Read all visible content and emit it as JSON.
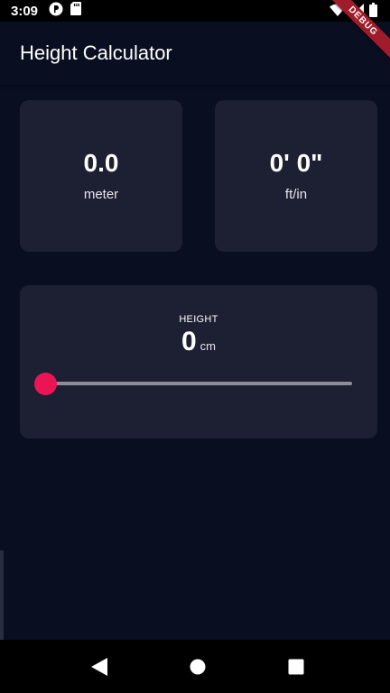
{
  "status_bar": {
    "time": "3:09",
    "icons_left": [
      "fuchsia-icon",
      "sd-card-icon"
    ],
    "icons_right": [
      "wifi-icon",
      "signal-icon",
      "battery-icon"
    ]
  },
  "debug_banner": "DEBUG",
  "app_bar": {
    "title": "Height Calculator"
  },
  "meter_card": {
    "value": "0.0",
    "unit": "meter"
  },
  "ftin_card": {
    "value": "0' 0\"",
    "unit": "ft/in"
  },
  "height_card": {
    "label": "HEIGHT",
    "value": "0",
    "unit": "cm",
    "slider_fraction": 0
  },
  "nav_bar": {
    "buttons": [
      "back-icon",
      "home-icon",
      "recents-icon"
    ]
  },
  "colors": {
    "background": "#0a0e21",
    "card": "#1d1f33",
    "accent": "#eb1555",
    "track": "#8d8e98"
  }
}
